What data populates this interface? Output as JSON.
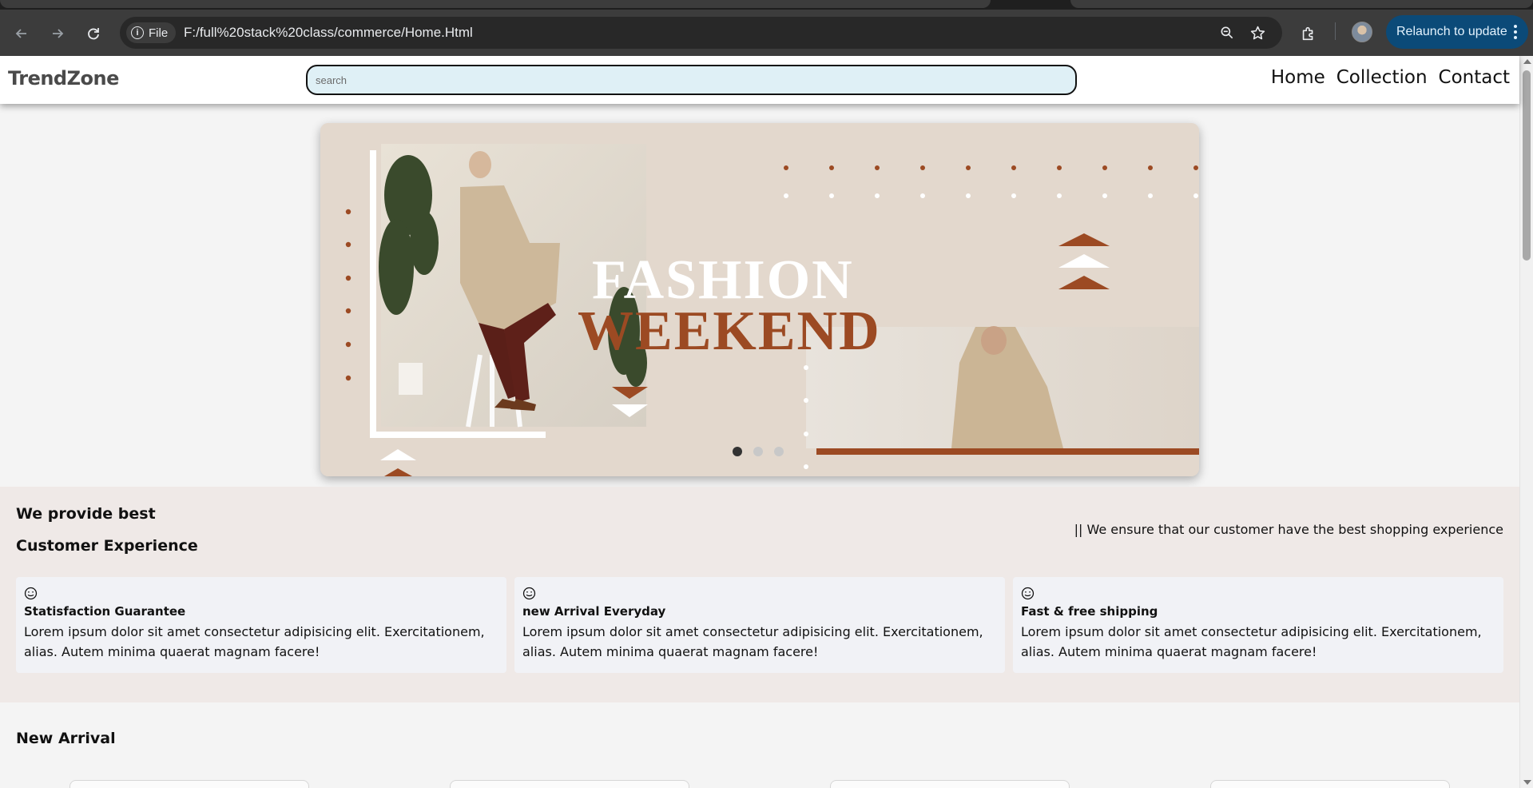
{
  "browser": {
    "url": "F:/full%20stack%20class/commerce/Home.Html",
    "site_chip_label": "File",
    "relaunch_label": "Relaunch to update"
  },
  "site": {
    "brand": "TrendZone",
    "search_placeholder": "search",
    "nav": [
      "Home",
      "Collection",
      "Contact"
    ]
  },
  "hero": {
    "line1": "FASHION",
    "line2": "WEEKEND",
    "slide_count": 3,
    "active_slide": 1
  },
  "experience": {
    "title_line1": "We provide best",
    "title_line2": "Customer Experience",
    "tagline": "|| We ensure that our customer have the best shopping experience",
    "cards": [
      {
        "icon": "smiley-icon",
        "title": "Statisfaction Guarantee",
        "text": "Lorem ipsum dolor sit amet consectetur adipisicing elit. Exercitationem, alias. Autem minima quaerat magnam facere!"
      },
      {
        "icon": "smiley-icon",
        "title": "new Arrival Everyday",
        "text": "Lorem ipsum dolor sit amet consectetur adipisicing elit. Exercitationem, alias. Autem minima quaerat magnam facere!"
      },
      {
        "icon": "smiley-icon",
        "title": "Fast & free shipping",
        "text": "Lorem ipsum dolor sit amet consectetur adipisicing elit. Exercitationem, alias. Autem minima quaerat magnam facere!"
      }
    ]
  },
  "new_arrival": {
    "title": "New Arrival"
  },
  "colors": {
    "search_bg": "#dff0f6",
    "hero_accent": "#9c4a23",
    "relaunch_bg": "#0b4a78",
    "experience_bg": "#efe9e7",
    "card_bg": "#f1f2f6"
  }
}
